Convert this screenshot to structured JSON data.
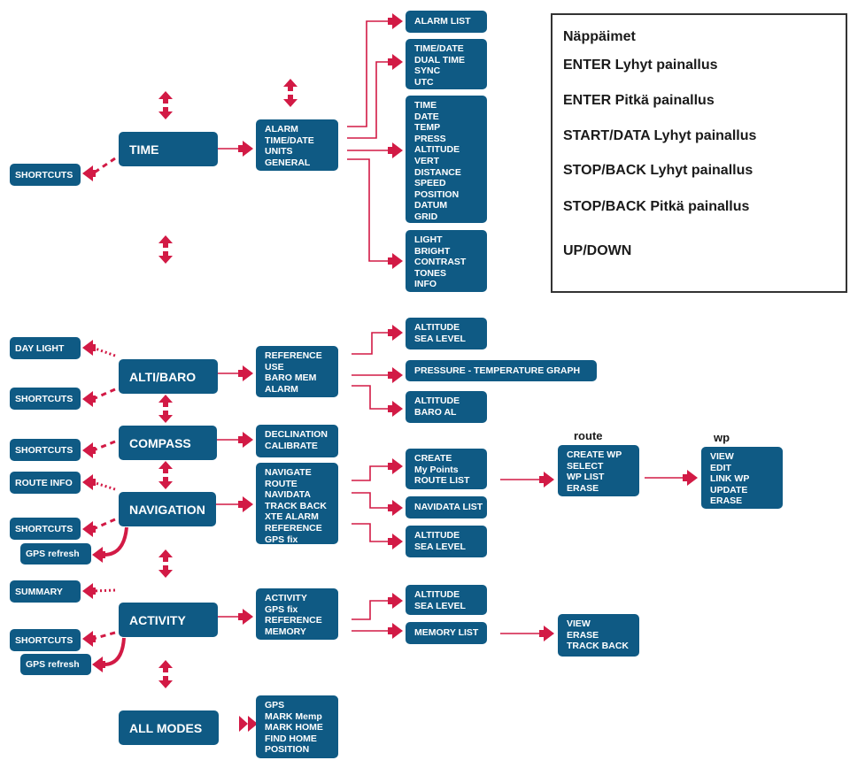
{
  "colors": {
    "box": "#0f5a84",
    "arrow": "#d21a45",
    "text_on_box": "#ffffff"
  },
  "legend": {
    "title": "Näppäimet",
    "rows": [
      {
        "label": "ENTER Lyhyt painallus",
        "icon": "arrow-thin-right"
      },
      {
        "label": "ENTER Pitkä painallus",
        "icon": "arrow-double-right"
      },
      {
        "label": "START/DATA Lyhyt painallus",
        "icon": "arrow-dotted-right"
      },
      {
        "label": "STOP/BACK Lyhyt painallus",
        "icon": "arrow-dashed-right"
      },
      {
        "label": "STOP/BACK Pitkä painallus",
        "icon": "arrow-solid-right"
      },
      {
        "label": "UP/DOWN",
        "icon": "arrow-up-down"
      }
    ]
  },
  "modes": {
    "time": "TIME",
    "alti_baro": "ALTI/BARO",
    "compass": "COMPASS",
    "navigation": "NAVIGATION",
    "activity": "ACTIVITY",
    "all_modes": "ALL MODES"
  },
  "side": {
    "time_shortcuts": "SHORTCUTS",
    "alti_daylight": "DAY LIGHT",
    "alti_shortcuts": "SHORTCUTS",
    "compass_shortcuts": "SHORTCUTS",
    "nav_routeinfo": "ROUTE INFO",
    "nav_shortcuts": "SHORTCUTS",
    "nav_gps": "GPS refresh",
    "act_summary": "SUMMARY",
    "act_shortcuts": "SHORTCUTS",
    "act_gps": "GPS refresh"
  },
  "menus": {
    "time": [
      "ALARM",
      "TIME/DATE",
      "UNITS",
      "GENERAL"
    ],
    "alti": [
      "REFERENCE",
      "USE",
      "BARO MEM",
      "ALARM"
    ],
    "compass": [
      "DECLINATION",
      "CALIBRATE"
    ],
    "nav": [
      "NAVIGATE",
      "ROUTE",
      "NAVIDATA",
      "TRACK BACK",
      "XTE ALARM",
      "REFERENCE",
      "GPS fix"
    ],
    "activity": [
      "ACTIVITY",
      "GPS fix",
      "REFERENCE",
      "MEMORY"
    ],
    "all": [
      "GPS",
      "MARK Memp",
      "MARK HOME",
      "FIND HOME",
      "POSITION"
    ]
  },
  "submenus": {
    "alarm_list": [
      "ALARM LIST"
    ],
    "timedate": [
      "TIME/DATE",
      "DUAL TIME",
      "SYNC",
      "UTC"
    ],
    "units": [
      "TIME",
      "DATE",
      "TEMP",
      "PRESS",
      "ALTITUDE",
      "VERT",
      "DISTANCE",
      "SPEED",
      "POSITION",
      "DATUM",
      "GRID"
    ],
    "general": [
      "LIGHT",
      "BRIGHT",
      "CONTRAST",
      "TONES",
      "INFO"
    ],
    "alti_ref": [
      "ALTITUDE",
      "SEA LEVEL"
    ],
    "alti_graph": [
      "PRESSURE - TEMPERATURE  GRAPH"
    ],
    "alti_alarm": [
      "ALTITUDE",
      "BARO AL"
    ],
    "nav_route": [
      "CREATE",
      "My Points",
      "ROUTE LIST"
    ],
    "nav_navidata": [
      "NAVIDATA LIST"
    ],
    "nav_ref": [
      "ALTITUDE",
      "SEA LEVEL"
    ],
    "act_ref": [
      "ALTITUDE",
      "SEA LEVEL"
    ],
    "act_memory": [
      "MEMORY LIST"
    ],
    "route": [
      "CREATE WP",
      "SELECT",
      "WP LIST",
      "ERASE"
    ],
    "wp": [
      "VIEW",
      "EDIT",
      "LINK WP",
      "UPDATE",
      "ERASE"
    ],
    "memory_actions": [
      "VIEW",
      "ERASE",
      "TRACK BACK"
    ]
  },
  "labels": {
    "route": "route",
    "wp": "wp"
  }
}
